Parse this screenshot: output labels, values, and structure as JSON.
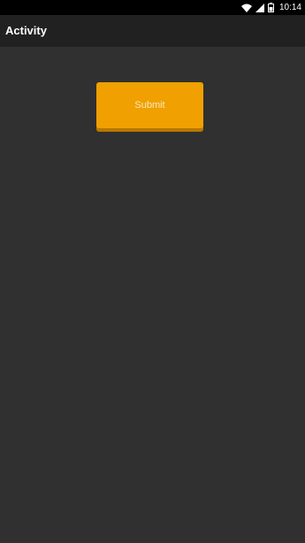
{
  "status_bar": {
    "time": "10:14",
    "icons": [
      "wifi-icon",
      "signal-icon",
      "battery-icon"
    ]
  },
  "app_bar": {
    "title": "Activity"
  },
  "main": {
    "submit_label": "Submit"
  },
  "colors": {
    "background": "#303030",
    "app_bar": "#212121",
    "status_bar": "#000000",
    "accent": "#f0a000"
  }
}
